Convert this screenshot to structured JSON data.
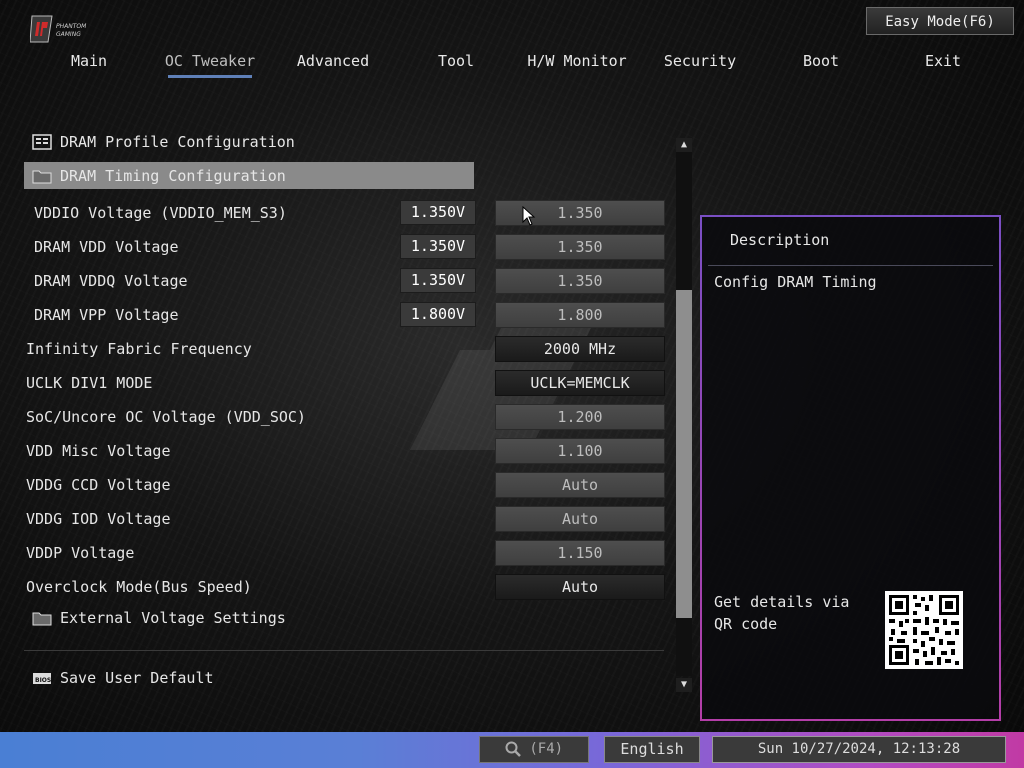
{
  "header": {
    "logo_text": "PHANTOM GAMING",
    "easy_mode_label": "Easy Mode(F6)"
  },
  "nav": {
    "tabs": [
      {
        "label": "Main"
      },
      {
        "label": "OC Tweaker"
      },
      {
        "label": "Advanced"
      },
      {
        "label": "Tool"
      },
      {
        "label": "H/W Monitor"
      },
      {
        "label": "Security"
      },
      {
        "label": "Boot"
      },
      {
        "label": "Exit"
      }
    ],
    "active_tab": "OC Tweaker"
  },
  "content": {
    "dram_profile": {
      "label": "DRAM Profile Configuration",
      "icon": "list-box-icon"
    },
    "dram_timing": {
      "label": "DRAM Timing Configuration",
      "icon": "folder-icon",
      "selected": true
    },
    "settings": [
      {
        "label": "VDDIO Voltage (VDDIO_MEM_S3)",
        "readout": "1.350V",
        "value": "1.350",
        "kind": "input"
      },
      {
        "label": "DRAM VDD Voltage",
        "readout": "1.350V",
        "value": "1.350",
        "kind": "input"
      },
      {
        "label": "DRAM VDDQ Voltage",
        "readout": "1.350V",
        "value": "1.350",
        "kind": "input"
      },
      {
        "label": "DRAM VPP Voltage",
        "readout": "1.800V",
        "value": "1.800",
        "kind": "input"
      },
      {
        "label": "Infinity Fabric Frequency",
        "value": "2000 MHz",
        "kind": "select"
      },
      {
        "label": "UCLK DIV1 MODE",
        "value": "UCLK=MEMCLK",
        "kind": "select"
      },
      {
        "label": "SoC/Uncore OC Voltage (VDD_SOC)",
        "value": "1.200",
        "kind": "input"
      },
      {
        "label": "VDD Misc Voltage",
        "value": "1.100",
        "kind": "input"
      },
      {
        "label": "VDDG CCD Voltage",
        "value": "Auto",
        "kind": "input"
      },
      {
        "label": "VDDG IOD Voltage",
        "value": "Auto",
        "kind": "input"
      },
      {
        "label": "VDDP Voltage",
        "value": "1.150",
        "kind": "input"
      },
      {
        "label": "Overclock Mode(Bus Speed)",
        "value": "Auto",
        "kind": "select"
      }
    ],
    "external_voltage": {
      "label": "External Voltage Settings",
      "icon": "folder-icon"
    },
    "save_user_default": {
      "label": "Save User Default",
      "icon": "bios-icon"
    }
  },
  "description": {
    "title": "Description",
    "body": "Config DRAM Timing",
    "qr_text": "Get details via QR code"
  },
  "footer": {
    "search_label": "(F4)",
    "language": "English",
    "datetime": "Sun 10/27/2024, 12:13:28"
  },
  "colors": {
    "active_tab_underline": "#5f80b8",
    "selected_row": "#8a8a8a",
    "description_border_top": "#7a4fc4",
    "description_border_bottom": "#b43ea8",
    "footer_gradient_start": "#4a7fd4",
    "footer_gradient_end": "#c13aa4"
  }
}
